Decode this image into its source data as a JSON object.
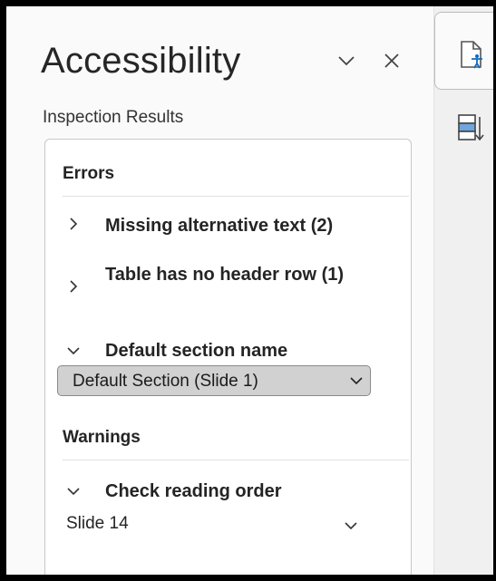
{
  "pane": {
    "title": "Accessibility",
    "section_label": "Inspection Results",
    "collapse_icon": "chevron-down-icon",
    "close_icon": "close-icon"
  },
  "results": {
    "errors_label": "Errors",
    "errors": [
      {
        "label": "Missing alternative text (2)",
        "expanded": false
      },
      {
        "label": "Table has no header row (1)",
        "expanded": false
      },
      {
        "label": "Default section name",
        "expanded": true,
        "selected_value": "Default Section (Slide 1)"
      }
    ],
    "warnings_label": "Warnings",
    "warnings": [
      {
        "label": "Check reading order",
        "expanded": true,
        "sub_item": "Slide 14"
      }
    ]
  },
  "toolbar": {
    "accessibility_icon": "accessibility-document-icon",
    "reading_order_icon": "reading-order-icon"
  },
  "colors": {
    "frame": "#000000",
    "pane_bg": "#fafafa",
    "select_bg": "#d1d1d1",
    "accent": "#0f6cbd"
  }
}
